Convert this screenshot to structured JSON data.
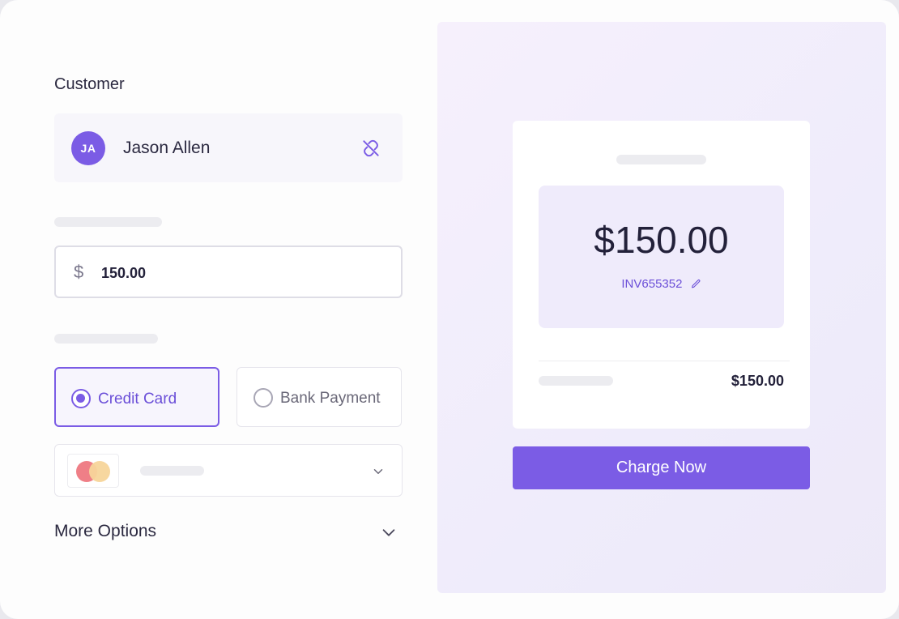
{
  "customer": {
    "label": "Customer",
    "initials": "JA",
    "name": "Jason Allen",
    "unlink_icon": "unlink-icon"
  },
  "amount": {
    "currency_symbol": "$",
    "value": "150.00"
  },
  "payment_methods": [
    {
      "label": "Credit Card",
      "selected": true
    },
    {
      "label": "Bank Payment",
      "selected": false
    }
  ],
  "card_select": {
    "card_icon": "mastercard-icon",
    "chevron_icon": "chevron-down-icon"
  },
  "more_options": {
    "label": "More Options",
    "chevron_icon": "chevron-down-icon"
  },
  "summary": {
    "amount": "$150.00",
    "invoice_id": "INV655352",
    "edit_icon": "pencil-icon",
    "total": "$150.00"
  },
  "charge_button": {
    "label": "Charge Now"
  },
  "colors": {
    "accent": "#7b5ce5",
    "accent_text": "#6b4fd8",
    "panel_bg": "#f3eefc",
    "amount_box_bg": "#efebfb"
  }
}
